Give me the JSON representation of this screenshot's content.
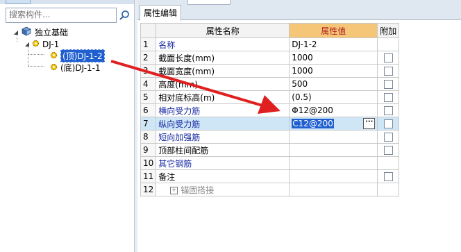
{
  "search": {
    "placeholder": "搜索构件..."
  },
  "tree": {
    "root": "独立基础",
    "child": "DJ-1",
    "leaf_selected": "(顶)DJ-1-2",
    "leaf_other": "(底)DJ-1-1"
  },
  "tab": {
    "label": "属性编辑"
  },
  "grid": {
    "headers": {
      "name": "属性名称",
      "value": "属性值",
      "extra": "附加"
    },
    "rows": [
      {
        "num": "1",
        "name": "名称",
        "value": "DJ-1-2",
        "checkbox": false
      },
      {
        "num": "2",
        "name": "截面长度(mm)",
        "value": "1000",
        "checkbox": true
      },
      {
        "num": "3",
        "name": "截面宽度(mm)",
        "value": "1000",
        "checkbox": true
      },
      {
        "num": "4",
        "name": "高度(mm)",
        "value": "500",
        "checkbox": true
      },
      {
        "num": "5",
        "name": "相对底标高(m)",
        "value": "(0.5)",
        "checkbox": true
      },
      {
        "num": "6",
        "name": "横向受力筋",
        "value": "Φ12@200",
        "checkbox": true
      },
      {
        "num": "7",
        "name": "纵向受力筋",
        "value": "C12@200",
        "checkbox": true
      },
      {
        "num": "8",
        "name": "短向加强筋",
        "value": "",
        "checkbox": true
      },
      {
        "num": "9",
        "name": "顶部柱间配筋",
        "value": "",
        "checkbox": true
      },
      {
        "num": "10",
        "name": "其它钢筋",
        "value": "",
        "checkbox": false
      },
      {
        "num": "11",
        "name": "备注",
        "value": "",
        "checkbox": true
      },
      {
        "num": "12",
        "name": "锚固搭接",
        "value": "",
        "checkbox": false
      }
    ]
  },
  "colors": {
    "selection": "#1f5fd0",
    "header_value_bg": "#f6c678",
    "arrow": "#e02020",
    "active_row": "#cfe6f7"
  }
}
